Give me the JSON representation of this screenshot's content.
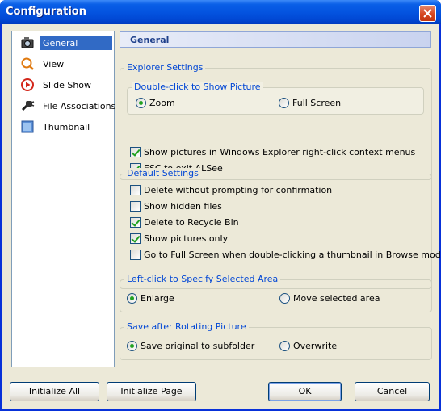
{
  "window": {
    "title": "Configuration"
  },
  "nav": {
    "items": [
      {
        "label": "General",
        "icon": "camera-icon",
        "selected": true
      },
      {
        "label": "View",
        "icon": "magnifier-icon",
        "selected": false
      },
      {
        "label": "Slide Show",
        "icon": "play-icon",
        "selected": false
      },
      {
        "label": "File Associations",
        "icon": "link-plug-icon",
        "selected": false
      },
      {
        "label": "Thumbnail",
        "icon": "thumbnail-icon",
        "selected": false
      }
    ]
  },
  "page": {
    "header": "General",
    "explorer": {
      "legend": "Explorer Settings",
      "dblclick": {
        "legend": "Double-click to Show Picture",
        "zoom": {
          "label": "Zoom",
          "selected": true
        },
        "fullscreen": {
          "label": "Full Screen",
          "selected": false
        }
      },
      "context_menu": {
        "label": "Show pictures in Windows Explorer right-click context menus",
        "checked": true
      },
      "esc_exit": {
        "label": "ESC to exit ALSee",
        "checked": true
      }
    },
    "defaults": {
      "legend": "Default Settings",
      "delete_no_confirm": {
        "label": "Delete without prompting for confirmation",
        "checked": false
      },
      "show_hidden": {
        "label": "Show hidden files",
        "checked": false
      },
      "recycle_bin": {
        "label": "Delete to Recycle Bin",
        "checked": true
      },
      "pictures_only": {
        "label": "Show pictures only",
        "checked": true
      },
      "fullscreen_dblclick": {
        "label": "Go to Full Screen when double-clicking a thumbnail in Browse mode",
        "checked": false
      }
    },
    "left_click": {
      "legend": "Left-click to Specify Selected Area",
      "enlarge": {
        "label": "Enlarge",
        "selected": true
      },
      "move": {
        "label": "Move selected area",
        "selected": false
      }
    },
    "rotate": {
      "legend": "Save after Rotating Picture",
      "subfolder": {
        "label": "Save original to subfolder",
        "selected": true
      },
      "overwrite": {
        "label": "Overwrite",
        "selected": false
      }
    }
  },
  "buttons": {
    "init_all": "Initialize All",
    "init_page": "Initialize Page",
    "ok": "OK",
    "cancel": "Cancel"
  },
  "colors": {
    "title_bar": "#0454e0",
    "selection": "#316ac5",
    "legend_text": "#0046d5",
    "check_green": "#21a121"
  }
}
